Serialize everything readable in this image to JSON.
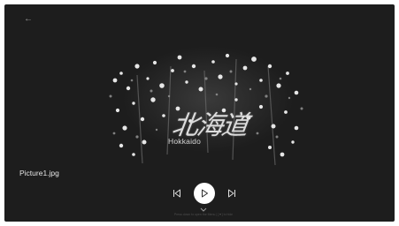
{
  "app": {
    "background": "#1d1d1d",
    "accent": "#ffffff"
  },
  "header": {
    "back_icon": "arrow-left-icon",
    "back_glyph": "←"
  },
  "photo": {
    "title_text": "北海道",
    "subtitle_text": "Hokkaido"
  },
  "file": {
    "name": "Picture1.jpg"
  },
  "controls": {
    "previous_icon": "skip-previous-icon",
    "play_icon": "play-icon",
    "next_icon": "skip-next-icon",
    "expand_icon": "chevron-down-icon"
  },
  "hint": {
    "text": "Press  down  to open the Menu  |  [▼] to hide"
  }
}
